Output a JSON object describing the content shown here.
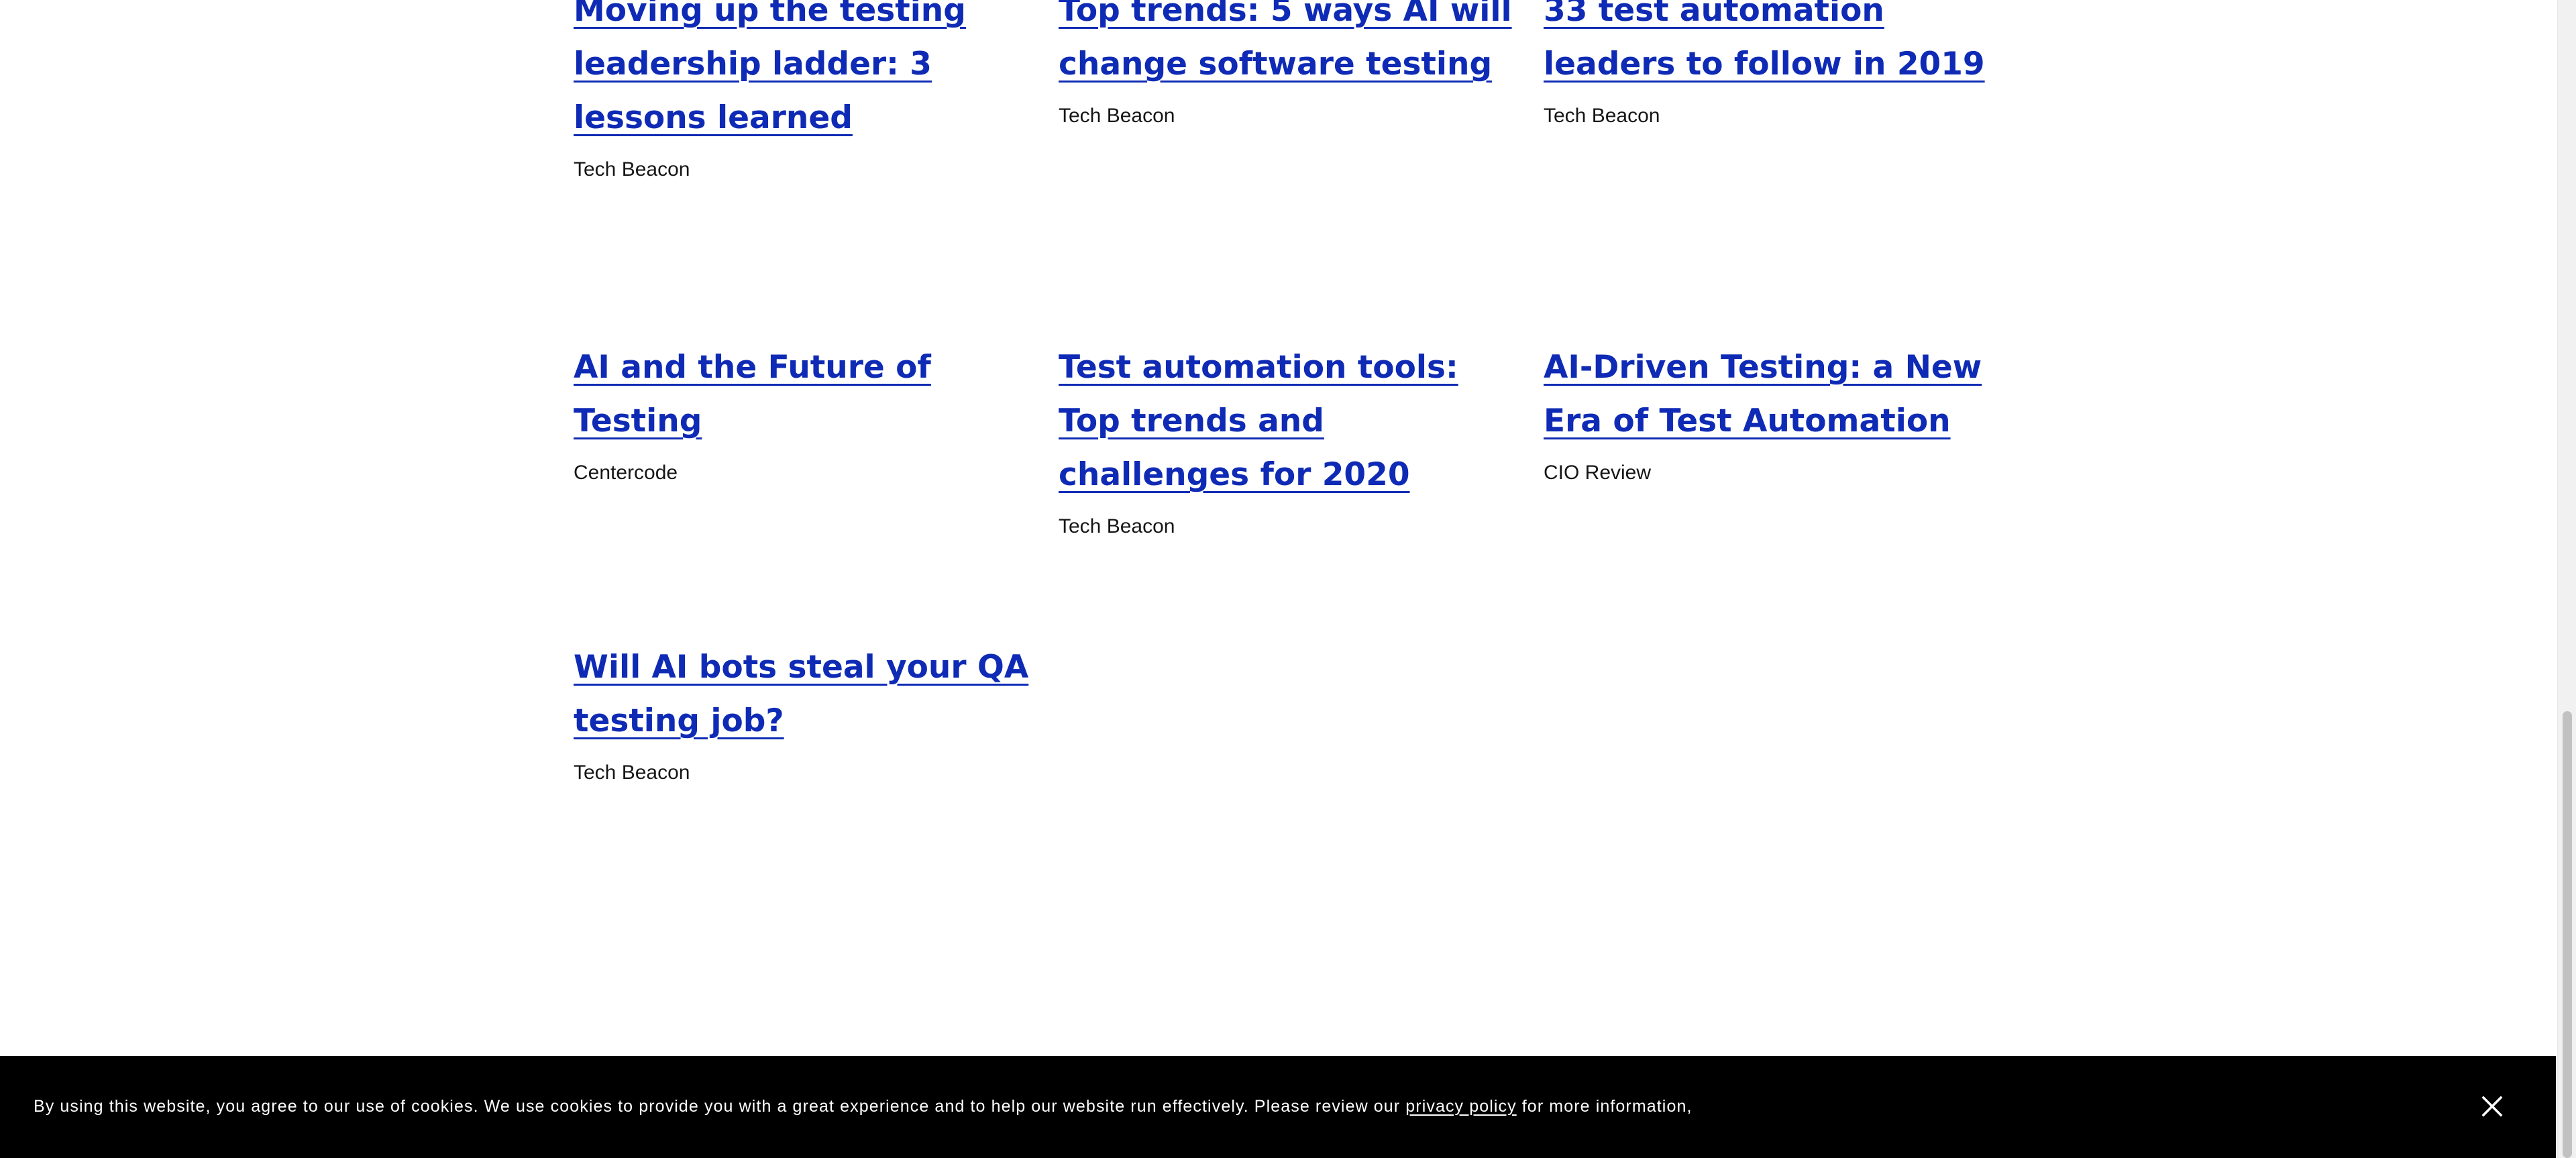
{
  "articles": [
    {
      "title": "Moving up the testing leadership ladder: 3 lessons learned",
      "source": "Tech Beacon"
    },
    {
      "title": "Top trends: 5 ways AI will change software testing",
      "source": "Tech Beacon"
    },
    {
      "title": "33 test automation leaders to follow in 2019",
      "source": "Tech Beacon"
    },
    {
      "title": "AI and the Future of Testing",
      "source": "Centercode"
    },
    {
      "title": "Test automation tools: Top trends and challenges for 2020",
      "source": "Tech Beacon"
    },
    {
      "title": "AI-Driven Testing: a New Era of Test Automation",
      "source": "CIO Review"
    },
    {
      "title": "Will AI bots steal your QA testing job?",
      "source": "Tech Beacon"
    }
  ],
  "cookie_banner": {
    "text_before": "By using this website, you agree to our use of cookies. We use cookies to provide you with a great experience and to help our website run effectively. Please review our",
    "link_label": "privacy policy",
    "text_after": "for more information,"
  },
  "colors": {
    "link": "#0f2bb5",
    "text": "#161616",
    "banner_background": "#000000"
  },
  "icons": {
    "close": "close-icon"
  }
}
